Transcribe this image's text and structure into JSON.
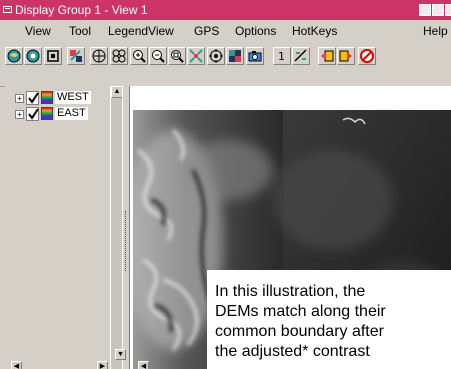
{
  "window": {
    "title": "Display Group 1 - View 1"
  },
  "menu": {
    "items": [
      "View",
      "Tool",
      "LegendView",
      "GPS",
      "Options",
      "HotKeys"
    ],
    "help": "Help"
  },
  "toolbar": {
    "buttons": [
      "view-world-icon",
      "view-layer-icon",
      "fit-screen-icon",
      "redraw-icon",
      "pan-icon",
      "roam-icon",
      "zoom-in-icon",
      "zoom-out-icon",
      "zoom-box-icon",
      "zoom-full-icon",
      "locate-icon",
      "grid-icon",
      "camera-icon",
      "scale-one-icon",
      "scale-tool-icon",
      "prev-view-icon",
      "next-view-icon",
      "stop-icon"
    ],
    "scale_label": "1"
  },
  "legend": {
    "layers": [
      {
        "name": "WEST",
        "checked": true
      },
      {
        "name": "EAST",
        "checked": true
      }
    ]
  },
  "caption": {
    "text": "In this illustration, the\nDEMs match along their\ncommon boundary after\nthe adjusted* contrast"
  },
  "colors": {
    "title_bar": "#cc3366",
    "panel": "#d4d0c8"
  }
}
